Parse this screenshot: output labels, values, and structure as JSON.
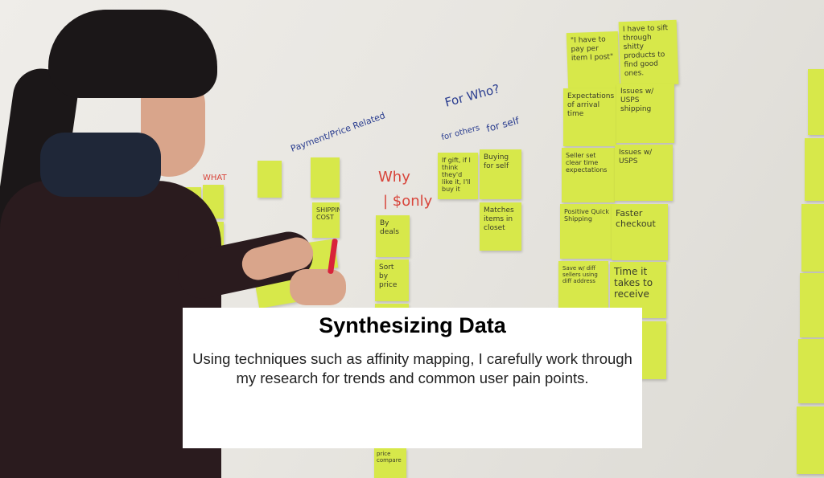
{
  "caption": {
    "title": "Synthesizing Data",
    "body": "Using techniques such as affinity mapping, I carefully work through my research for trends and common user pain points."
  },
  "wall_labels": {
    "payment": "Payment/Price Related",
    "for_who": "For Who?",
    "for_others": "for others",
    "for_self": "for self",
    "what": "WHAT",
    "why": "Why",
    "dollar_only": "| $only"
  },
  "notes": {
    "pay_per_item": "\"I have to pay per item I post\"",
    "sift_through": "I have to sift through shitty products to find good ones.",
    "expectations_arrival": "Expectations of arrival time",
    "issues_usps_shipping": "Issues w/ USPS shipping",
    "seller_set_expectations": "Seller set clear time expectations",
    "issues_usps": "Issues w/ USPS",
    "positive_shipping": "Positive Quick Shipping",
    "faster_checkout": "Faster checkout",
    "save_addresses": "Save w/ diff sellers using diff address",
    "time_to_receive": "Time it takes to receive",
    "if_gift": "If gift, if I think they'd like it, I'll buy it",
    "buying_for_self": "Buying for self",
    "matches_items": "Matches items in closet",
    "shipping_cost": "SHIPPING COST",
    "by_deals": "By deals",
    "sort_by_price": "Sort by price",
    "price_compare": "price compare"
  },
  "colors": {
    "sticky_note": "#d7e84a",
    "caption_bg": "#ffffff",
    "marker_blue": "#2a3d8f",
    "marker_red": "#d8453b"
  }
}
